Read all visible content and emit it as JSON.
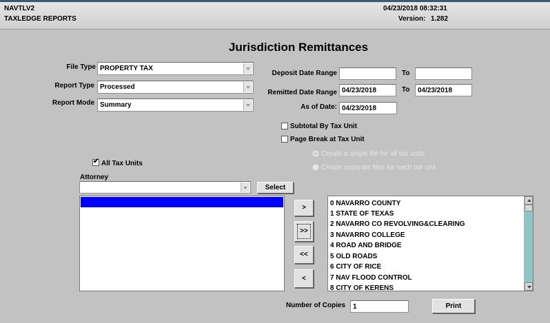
{
  "header": {
    "app_name": "NAVTLV2",
    "module": "TAXLEDGE REPORTS",
    "datetime": "04/23/2018 08:32:31",
    "version_label": "Version:",
    "version_value": "1.282"
  },
  "page_title": "Jurisdiction Remittances",
  "file_type": {
    "label": "File Type",
    "value": "PROPERTY TAX"
  },
  "report_type": {
    "label": "Report Type",
    "value": "Processed"
  },
  "report_mode": {
    "label": "Report Mode",
    "value": "Summary"
  },
  "deposit_range": {
    "label": "Deposit Date Range",
    "from": "",
    "to_label": "To",
    "to": ""
  },
  "remitted_range": {
    "label": "Remitted Date Range",
    "from": "04/23/2018",
    "to_label": "To",
    "to": "04/23/2018"
  },
  "as_of": {
    "label": "As of Date:",
    "value": "04/23/2018"
  },
  "options": {
    "subtotal_label": "Subtotal By Tax Unit",
    "subtotal_checked": false,
    "pagebreak_label": "Page Break at Tax Unit",
    "pagebreak_checked": false,
    "single_file_label": "Create a single file for all tax units",
    "separate_files_label": "Create separate files for each tax unit"
  },
  "all_tax_units": {
    "label": "All Tax Units",
    "checked": true,
    "mark": "✔"
  },
  "attorney": {
    "label": "Attorney",
    "value": "",
    "select_label": "Select"
  },
  "move_buttons": {
    "add_one": ">",
    "add_all": ">>",
    "remove_all": "<<",
    "remove_one": "<"
  },
  "tax_units": [
    "0 NAVARRO COUNTY",
    "1 STATE OF TEXAS",
    "2 NAVARRO CO REVOLVING&CLEARING",
    "3 NAVARRO COLLEGE",
    "4 ROAD AND BRIDGE",
    "5 OLD ROADS",
    "6 CITY OF RICE",
    "7 NAV FLOOD CONTROL",
    "8 CITY OF KERENS"
  ],
  "copies": {
    "label": "Number of Copies",
    "value": "1"
  },
  "print_label": "Print",
  "colors": {
    "selection": "#0000ff",
    "scrollbar": "#8ec5c5",
    "background": "#c2c2c2"
  }
}
